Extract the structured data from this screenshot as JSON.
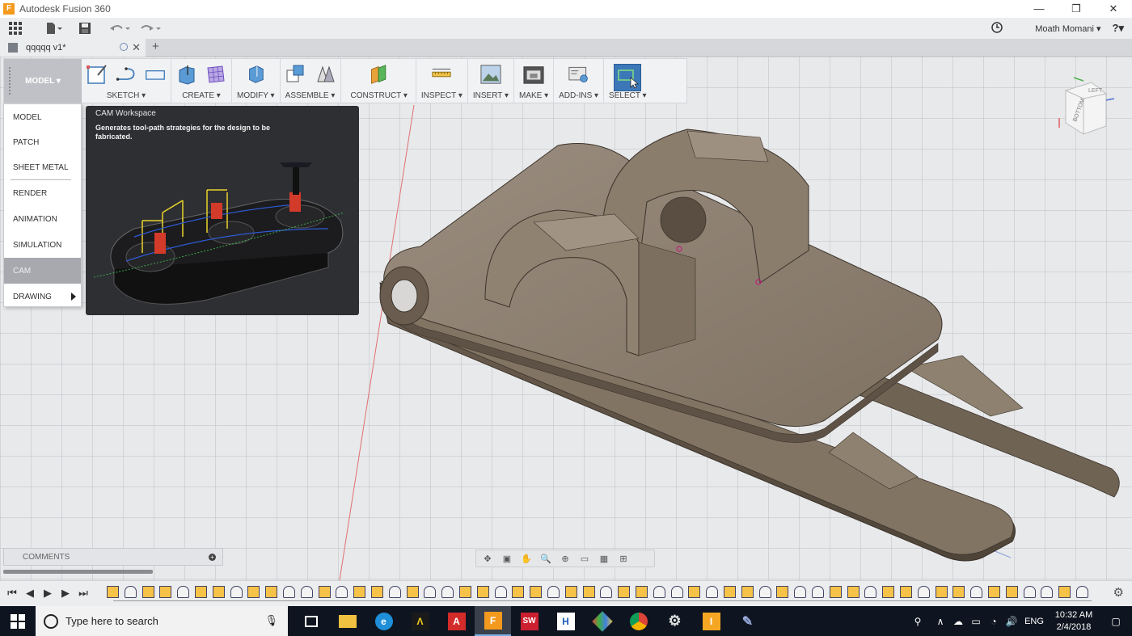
{
  "window": {
    "title": "Autodesk Fusion 360",
    "controls": [
      "—",
      "❐",
      "✕"
    ]
  },
  "qat": {
    "user": "Moath Momani ▾",
    "help": "?▾"
  },
  "document_tab": {
    "title": "qqqqq v1*",
    "close": "✕",
    "new_tab": "+"
  },
  "ribbon": {
    "workspace": "MODEL ▾",
    "groups": [
      {
        "label": "SKETCH ▾"
      },
      {
        "label": "CREATE ▾"
      },
      {
        "label": "MODIFY ▾"
      },
      {
        "label": "ASSEMBLE ▾"
      },
      {
        "label": "CONSTRUCT ▾"
      },
      {
        "label": "INSPECT ▾"
      },
      {
        "label": "INSERT ▾"
      },
      {
        "label": "MAKE ▾"
      },
      {
        "label": "ADD-INS ▾"
      },
      {
        "label": "SELECT ▾"
      }
    ]
  },
  "workspace_menu": {
    "items": [
      "MODEL",
      "PATCH",
      "SHEET METAL",
      "RENDER",
      "ANIMATION",
      "SIMULATION",
      "CAM",
      "DRAWING"
    ],
    "active": "CAM"
  },
  "tooltip": {
    "title": "CAM Workspace",
    "description": "Generates tool-path strategies for the design to be fabricated."
  },
  "viewcube": {
    "left": "LEFT",
    "bottom": "BOTTOM"
  },
  "comments": {
    "label": "COMMENTS",
    "add": "+"
  },
  "taskbar": {
    "search_placeholder": "Type here to search",
    "lang": "ENG",
    "time": "10:32 AM",
    "date": "2/4/2018"
  },
  "colors": {
    "accent": "#3c78b8",
    "part": "#8a7a68",
    "tooltip_bg": "#2e2f33",
    "taskbar": "#0f1520"
  }
}
